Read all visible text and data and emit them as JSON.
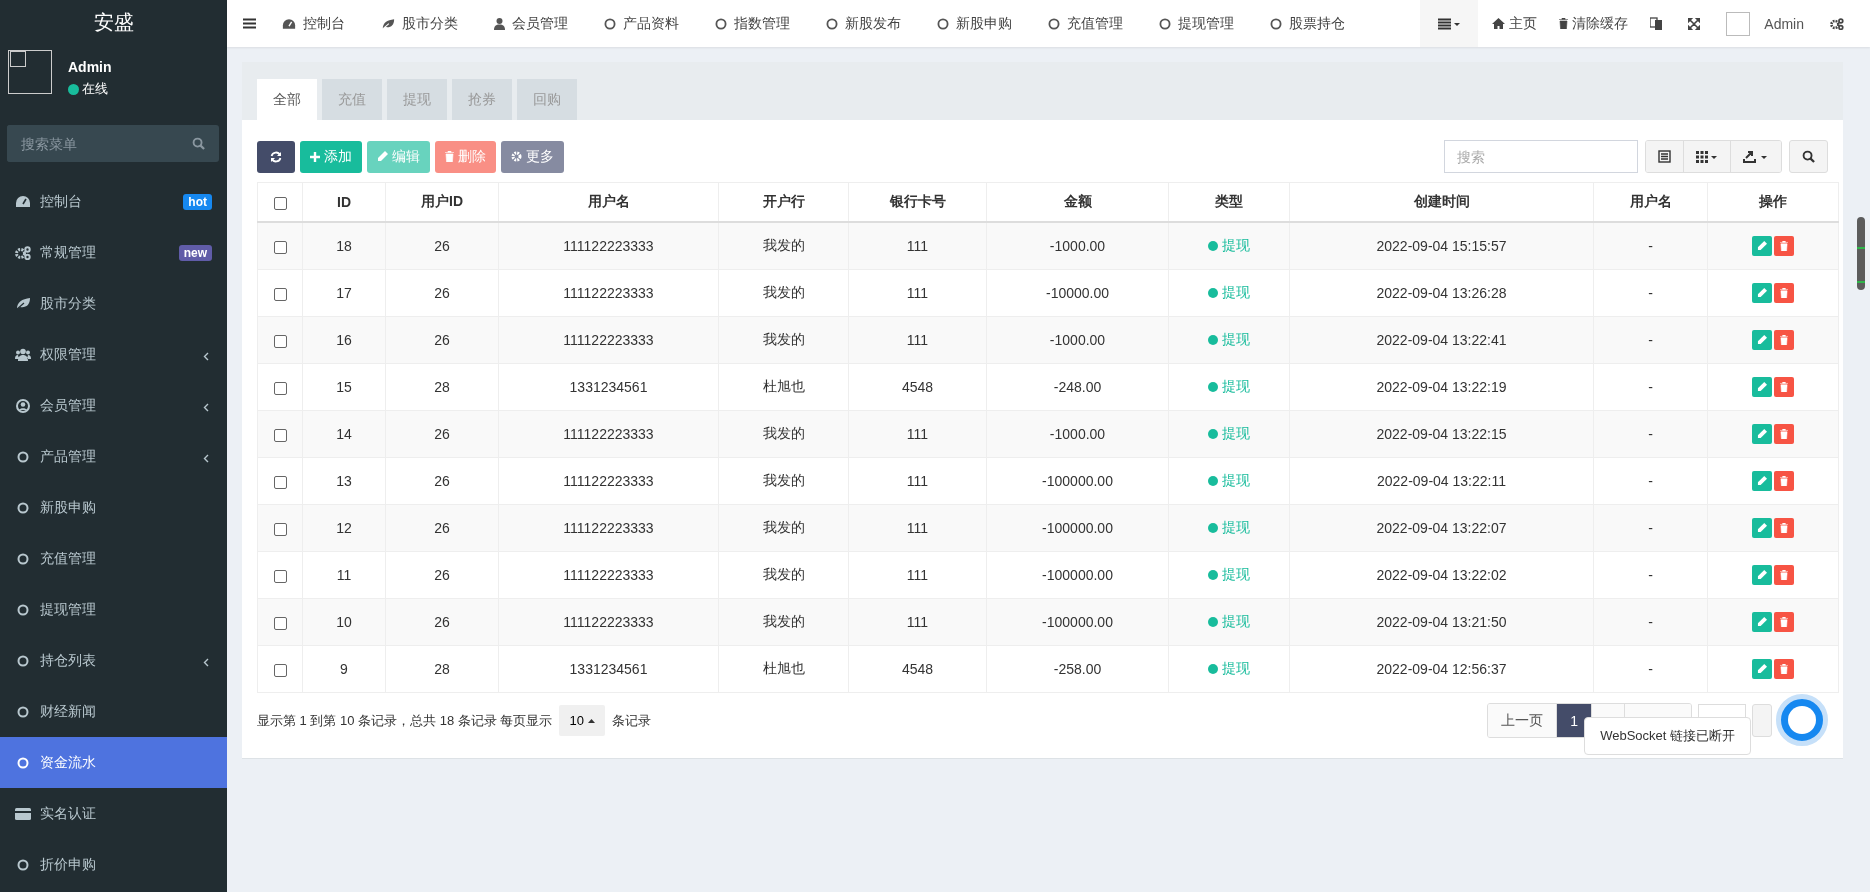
{
  "sidebar": {
    "logo": "安盛",
    "user": {
      "name": "Admin",
      "status": "在线"
    },
    "search": {
      "placeholder": "搜索菜单"
    },
    "items": [
      {
        "label": "控制台",
        "kind": "dashboard",
        "badge": "hot",
        "color": "#1688f0",
        "has_children": false,
        "selected": false
      },
      {
        "label": "常规管理",
        "kind": "gears",
        "badge": "new",
        "color": "#605ca8",
        "has_children": false,
        "selected": false
      },
      {
        "label": "股市分类",
        "kind": "leaf",
        "has_children": false,
        "selected": false
      },
      {
        "label": "权限管理",
        "kind": "users",
        "has_children": true,
        "selected": false
      },
      {
        "label": "会员管理",
        "kind": "user-circle",
        "has_children": true,
        "selected": false
      },
      {
        "label": "产品管理",
        "kind": "circle",
        "has_children": true,
        "selected": false
      },
      {
        "label": "新股申购",
        "kind": "circle",
        "has_children": false,
        "selected": false
      },
      {
        "label": "充值管理",
        "kind": "circle",
        "has_children": false,
        "selected": false
      },
      {
        "label": "提现管理",
        "kind": "circle",
        "has_children": false,
        "selected": false
      },
      {
        "label": "持仓列表",
        "kind": "circle",
        "has_children": true,
        "selected": false
      },
      {
        "label": "财经新闻",
        "kind": "circle",
        "has_children": false,
        "selected": false
      },
      {
        "label": "资金流水",
        "kind": "circle",
        "has_children": false,
        "selected": true
      },
      {
        "label": "实名认证",
        "kind": "card",
        "has_children": false,
        "selected": false
      },
      {
        "label": "折价申购",
        "kind": "circle",
        "has_children": false,
        "selected": false
      }
    ]
  },
  "topnav": {
    "items": [
      {
        "label": "控制台",
        "kind": "dashboard"
      },
      {
        "label": "股市分类",
        "kind": "leaf"
      },
      {
        "label": "会员管理",
        "kind": "user"
      },
      {
        "label": "产品资料",
        "kind": "circle"
      },
      {
        "label": "指数管理",
        "kind": "circle"
      },
      {
        "label": "新股发布",
        "kind": "circle"
      },
      {
        "label": "新股申购",
        "kind": "circle"
      },
      {
        "label": "充值管理",
        "kind": "circle"
      },
      {
        "label": "提现管理",
        "kind": "circle"
      },
      {
        "label": "股票持仓",
        "kind": "circle"
      }
    ],
    "home": "主页",
    "clear_cache": "清除缓存",
    "user": "Admin"
  },
  "tabs": [
    {
      "label": "全部",
      "selected": true
    },
    {
      "label": "充值",
      "selected": false
    },
    {
      "label": "提现",
      "selected": false
    },
    {
      "label": "抢券",
      "selected": false
    },
    {
      "label": "回购",
      "selected": false
    }
  ],
  "toolbar": {
    "buttons": [
      {
        "kind": "refresh",
        "disabled": false
      },
      {
        "kind": "add",
        "label": "添加",
        "disabled": false
      },
      {
        "kind": "edit",
        "label": "编辑",
        "disabled": true
      },
      {
        "kind": "delete",
        "label": "删除",
        "disabled": true
      },
      {
        "kind": "more",
        "label": "更多",
        "disabled": false
      }
    ],
    "search": {
      "placeholder": "搜索"
    }
  },
  "table": {
    "select_all_checked": false,
    "columns": [
      "ID",
      "用户ID",
      "用户名",
      "开户行",
      "银行卡号",
      "金额",
      "类型",
      "创建时间",
      "用户名",
      "操作"
    ],
    "rows": [
      {
        "checked": false,
        "cells": [
          "18",
          "26",
          "111122223333",
          "我发的",
          "111",
          "-1000.00",
          "提现",
          "2022-09-04 15:15:57",
          "-"
        ]
      },
      {
        "checked": false,
        "cells": [
          "17",
          "26",
          "111122223333",
          "我发的",
          "111",
          "-10000.00",
          "提现",
          "2022-09-04 13:26:28",
          "-"
        ]
      },
      {
        "checked": false,
        "cells": [
          "16",
          "26",
          "111122223333",
          "我发的",
          "111",
          "-1000.00",
          "提现",
          "2022-09-04 13:22:41",
          "-"
        ]
      },
      {
        "checked": false,
        "cells": [
          "15",
          "28",
          "1331234561",
          "杜旭也",
          "4548",
          "-248.00",
          "提现",
          "2022-09-04 13:22:19",
          "-"
        ]
      },
      {
        "checked": false,
        "cells": [
          "14",
          "26",
          "111122223333",
          "我发的",
          "111",
          "-1000.00",
          "提现",
          "2022-09-04 13:22:15",
          "-"
        ]
      },
      {
        "checked": false,
        "cells": [
          "13",
          "26",
          "111122223333",
          "我发的",
          "111",
          "-100000.00",
          "提现",
          "2022-09-04 13:22:11",
          "-"
        ]
      },
      {
        "checked": false,
        "cells": [
          "12",
          "26",
          "111122223333",
          "我发的",
          "111",
          "-100000.00",
          "提现",
          "2022-09-04 13:22:07",
          "-"
        ]
      },
      {
        "checked": false,
        "cells": [
          "11",
          "26",
          "111122223333",
          "我发的",
          "111",
          "-100000.00",
          "提现",
          "2022-09-04 13:22:02",
          "-"
        ]
      },
      {
        "checked": false,
        "cells": [
          "10",
          "26",
          "111122223333",
          "我发的",
          "111",
          "-100000.00",
          "提现",
          "2022-09-04 13:21:50",
          "-"
        ]
      },
      {
        "checked": false,
        "cells": [
          "9",
          "28",
          "1331234561",
          "杜旭也",
          "4548",
          "-258.00",
          "提现",
          "2022-09-04 12:56:37",
          "-"
        ]
      }
    ]
  },
  "footer": {
    "summary": "显示第 1 到第 10 条记录，总共 18 条记录 每页显示",
    "page_size": "10",
    "after": "条记录",
    "pages": [
      {
        "label": "上一页",
        "selected": false
      },
      {
        "label": "1",
        "selected": true
      }
    ]
  },
  "toast": "WebSocket 链接已断开"
}
